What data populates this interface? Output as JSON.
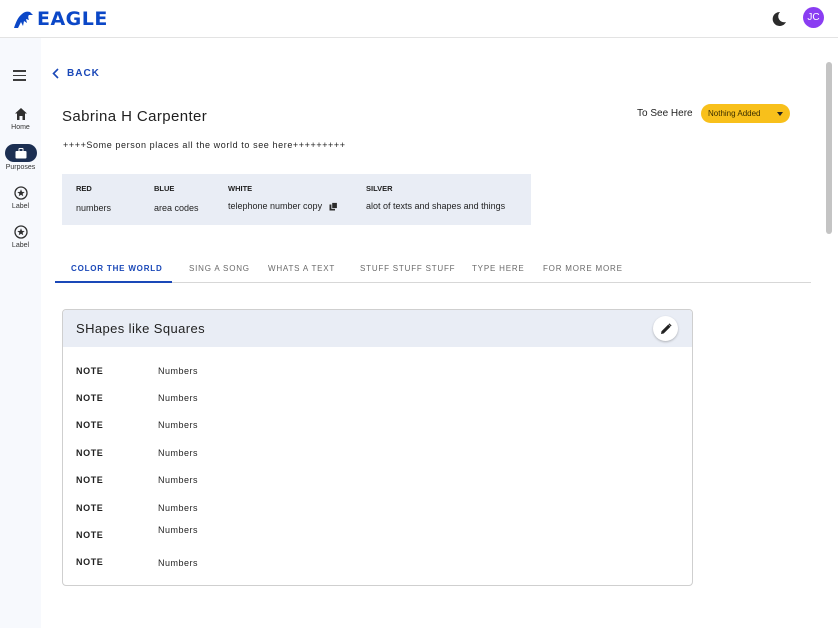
{
  "app": {
    "logo_text": "EAGLE",
    "avatar_initials": "JC",
    "accent": "#1a48b8",
    "avatar_color": "#8a3df2"
  },
  "sidebar": {
    "items": [
      {
        "label": "Home",
        "icon": "home-icon"
      },
      {
        "label": "Purposes",
        "icon": "briefcase-icon"
      },
      {
        "label": "Label",
        "icon": "star-icon"
      },
      {
        "label": "Label",
        "icon": "star-icon"
      }
    ]
  },
  "back_label": "BACK",
  "person": {
    "name": "Sabrina H Carpenter",
    "description": "++++Some person places all the world to see here+++++++++"
  },
  "see_here": {
    "label": "To See Here",
    "dropdown_value": "Nothing Added",
    "dropdown_color": "#f8c01b"
  },
  "info": [
    {
      "header": "RED",
      "value": "numbers"
    },
    {
      "header": "BLUE",
      "value": "area codes"
    },
    {
      "header": "WHITE",
      "value": "telephone number copy"
    },
    {
      "header": "SILVER",
      "value": "alot of texts and shapes and things"
    }
  ],
  "tabs": [
    {
      "label": "COLOR THE WORLD",
      "active": true
    },
    {
      "label": "SING A SONG"
    },
    {
      "label": "WHATS A TEXT"
    },
    {
      "label": "STUFF STUFF STUFF"
    },
    {
      "label": "TYPE HERE"
    },
    {
      "label": "FOR MORE MORE"
    }
  ],
  "card": {
    "title": "SHapes like Squares",
    "rows": [
      {
        "label": "NOTE",
        "value": "Numbers"
      },
      {
        "label": "NOTE",
        "value": "Numbers"
      },
      {
        "label": "NOTE",
        "value": "Numbers"
      },
      {
        "label": "NOTE",
        "value": "Numbers"
      },
      {
        "label": "NOTE",
        "value": "Numbers"
      },
      {
        "label": "NOTE",
        "value": "Numbers"
      },
      {
        "label": "NOTE",
        "value": "Numbers"
      },
      {
        "label": "NOTE",
        "value": "Numbers"
      }
    ]
  }
}
